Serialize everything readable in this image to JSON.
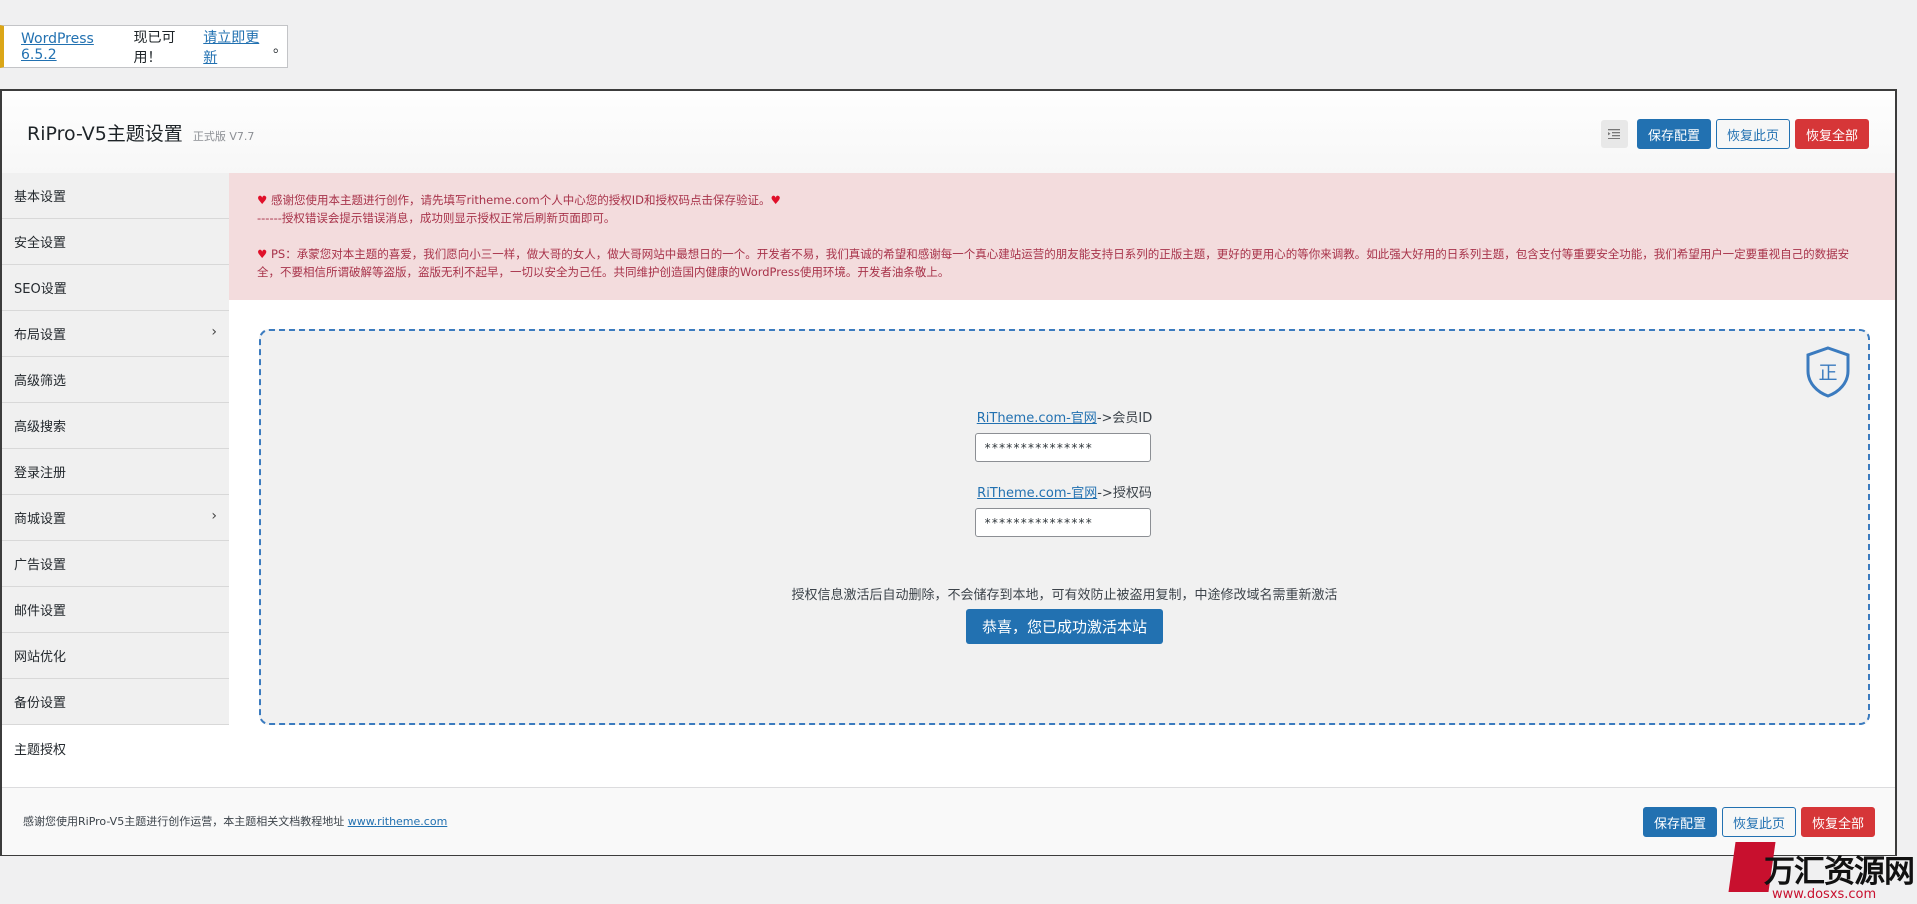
{
  "notice": {
    "version_link": "WordPress 6.5.2",
    "middle_text": " 现已可用！",
    "update_link": "请立即更新",
    "end_text": "。"
  },
  "header": {
    "title": "RiPro-V5主题设置",
    "version": "正式版 V7.7",
    "save_label": "保存配置",
    "restore_page_label": "恢复此页",
    "restore_all_label": "恢复全部"
  },
  "sidebar": {
    "items": [
      {
        "label": "基本设置",
        "has_children": false
      },
      {
        "label": "安全设置",
        "has_children": false
      },
      {
        "label": "SEO设置",
        "has_children": false
      },
      {
        "label": "布局设置",
        "has_children": true
      },
      {
        "label": "高级筛选",
        "has_children": false
      },
      {
        "label": "高级搜索",
        "has_children": false
      },
      {
        "label": "登录注册",
        "has_children": false
      },
      {
        "label": "商城设置",
        "has_children": true
      },
      {
        "label": "广告设置",
        "has_children": false
      },
      {
        "label": "邮件设置",
        "has_children": false
      },
      {
        "label": "网站优化",
        "has_children": false
      },
      {
        "label": "备份设置",
        "has_children": false
      },
      {
        "label": "主题授权",
        "has_children": false,
        "active": true
      }
    ]
  },
  "alert": {
    "line1": " 感谢您使用本主题进行创作，请先填写ritheme.com个人中心您的授权ID和授权码点击保存验证。",
    "line2": "------授权错误会提示错误消息，成功则显示授权正常后刷新页面即可。",
    "line3": " PS：承蒙您对本主题的喜爱，我们愿向小三一样，做大哥的女人，做大哥网站中最想日的一个。开发者不易，我们真诚的希望和感谢每一个真心建站运营的朋友能支持日系列的正版主题，更好的更用心的等你来调教。如此强大好用的日系列主题，包含支付等重要安全功能，我们希望用户一定要重视自己的数据安全，不要相信所谓破解等盗版，盗版无利不起早，一切以安全为己任。共同维护创造国内健康的WordPress使用环境。开发者油条敬上。"
  },
  "license": {
    "shield_label": "正",
    "member_link": "RiTheme.com-官网",
    "member_suffix": "->会员ID",
    "member_value": "***************",
    "code_link": "RiTheme.com-官网",
    "code_suffix": "->授权码",
    "code_value": "***************",
    "info": "授权信息激活后自动删除，不会储存到本地，可有效防止被盗用复制，中途修改域名需重新激活",
    "activate_label": "恭喜，您已成功激活本站"
  },
  "footer": {
    "text": "感谢您使用RiPro-V5主题进行创作运营，本主题相关文档教程地址 ",
    "link": "www.ritheme.com",
    "save_label": "保存配置",
    "restore_page_label": "恢复此页",
    "restore_all_label": "恢复全部"
  },
  "watermark": {
    "text": "万汇资源网",
    "url": "www.dosxs.com"
  },
  "colors": {
    "primary": "#2271b1",
    "danger": "#d63638",
    "alert_bg": "#f3dcdd",
    "alert_text": "#a8334a",
    "notice_border": "#dba617"
  }
}
